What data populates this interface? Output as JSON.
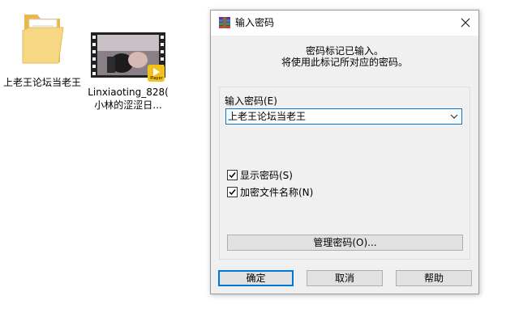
{
  "desktop": {
    "folder": {
      "label": "上老王论坛当老王"
    },
    "video": {
      "label_line1": "Linxiaoting_828(",
      "label_line2": "小林的涩涩日...",
      "badge": "Player"
    }
  },
  "dialog": {
    "title": "输入密码",
    "message_line1": "密码标记已输入。",
    "message_line2": "将使用此标记所对应的密码。",
    "password_label": "输入密码(E)",
    "password_value": "上老王论坛当老王",
    "show_password": {
      "label": "显示密码(S)",
      "checked": true
    },
    "encrypt_names": {
      "label": "加密文件名称(N)",
      "checked": true
    },
    "manage_button": "管理密码(O)...",
    "ok_button": "确定",
    "cancel_button": "取消",
    "help_button": "帮助"
  },
  "colors": {
    "accent": "#0078d7",
    "dialog_bg": "#f0f0f0",
    "folder": "#f4d27a"
  }
}
